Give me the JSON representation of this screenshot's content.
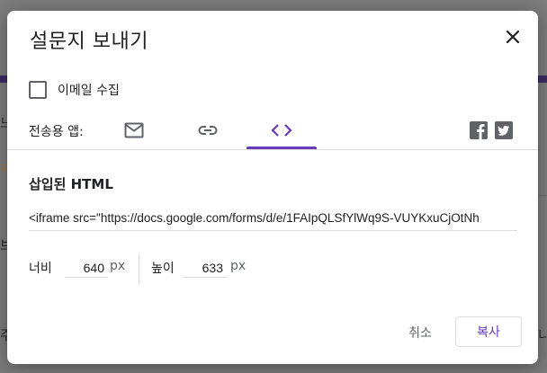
{
  "dialog": {
    "title": "설문지 보내기",
    "email_collect": {
      "label": "이메일 수집",
      "checked": false
    },
    "send_via_label": "전송용 앱:",
    "tabs": [
      {
        "icon": "mail-icon",
        "active": false
      },
      {
        "icon": "link-icon",
        "active": false
      },
      {
        "icon": "embed-code-icon",
        "active": true
      }
    ],
    "share_icons": [
      "facebook-icon",
      "twitter-icon"
    ],
    "embed": {
      "title": "삽입된 HTML",
      "code": "<iframe src=\"https://docs.google.com/forms/d/e/1FAIpQLSfYlWq9S-VUYKxuCjOtNh"
    },
    "dimensions": {
      "width_label": "너비",
      "width_value": "640",
      "height_label": "높이",
      "height_value": "633",
      "unit": "px"
    },
    "buttons": {
      "cancel": "취소",
      "copy": "복사"
    }
  },
  "background": {
    "fragments": [
      "느",
      "ㄹ",
      "브",
      "주",
      "니"
    ]
  },
  "colors": {
    "accent": "#673ab7",
    "icon": "#5f6368",
    "divider": "#dadce0",
    "scrim": "#7b7b7b"
  }
}
